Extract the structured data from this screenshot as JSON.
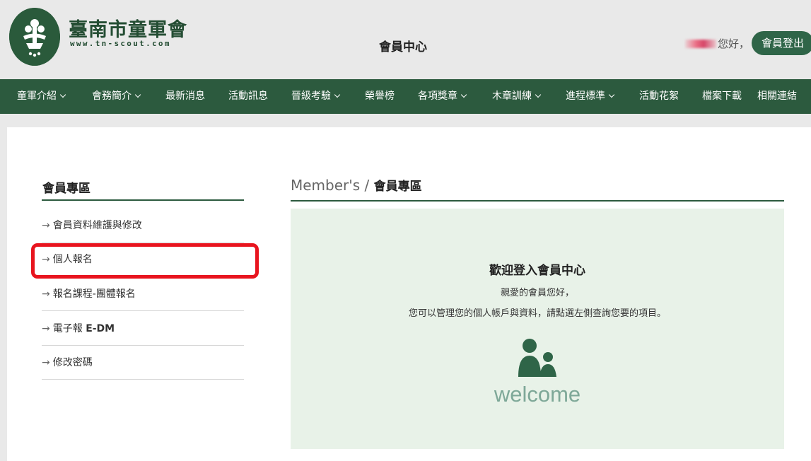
{
  "header": {
    "brand_title": "臺南市童軍會",
    "brand_url": "www.tn-scout.com",
    "center_title": "會員中心",
    "greeting_suffix": "您好，",
    "logout_label": "會員登出"
  },
  "nav": {
    "items": [
      {
        "label": "童軍介紹",
        "dropdown": true
      },
      {
        "label": "會務簡介",
        "dropdown": true
      },
      {
        "label": "最新消息",
        "dropdown": false
      },
      {
        "label": "活動訊息",
        "dropdown": false
      },
      {
        "label": "晉級考驗",
        "dropdown": true
      },
      {
        "label": "榮譽榜",
        "dropdown": false
      },
      {
        "label": "各項獎章",
        "dropdown": true
      },
      {
        "label": "木章訓練",
        "dropdown": true
      },
      {
        "label": "進程標準",
        "dropdown": true
      },
      {
        "label": "活動花絮",
        "dropdown": false
      },
      {
        "label": "檔案下載",
        "dropdown": false
      },
      {
        "label": "相關連結",
        "dropdown": false
      }
    ]
  },
  "sidebar": {
    "title": "會員專區",
    "arrow": "→",
    "items": [
      {
        "label": "會員資料維護與修改"
      },
      {
        "label": "個人報名",
        "highlighted": true
      },
      {
        "label": "報名課程-團體報名"
      },
      {
        "label": "電子報 ",
        "label_bold": "E-DM"
      },
      {
        "label": "修改密碼"
      }
    ]
  },
  "main": {
    "title_en": "Member's / ",
    "title_zh": "會員專區",
    "panel": {
      "heading": "歡迎登入會員中心",
      "line1": "親愛的會員您好，",
      "line2": "您可以管理您的個人帳戶與資料，請點選左側查詢您要的項目。",
      "icon": "people-icon",
      "welcome": "welcome"
    }
  },
  "colors": {
    "brand_green": "#2c5a3e",
    "panel_bg": "#e8f2e8",
    "welcome_text": "#7ea898",
    "highlight_red": "#e8141e"
  }
}
